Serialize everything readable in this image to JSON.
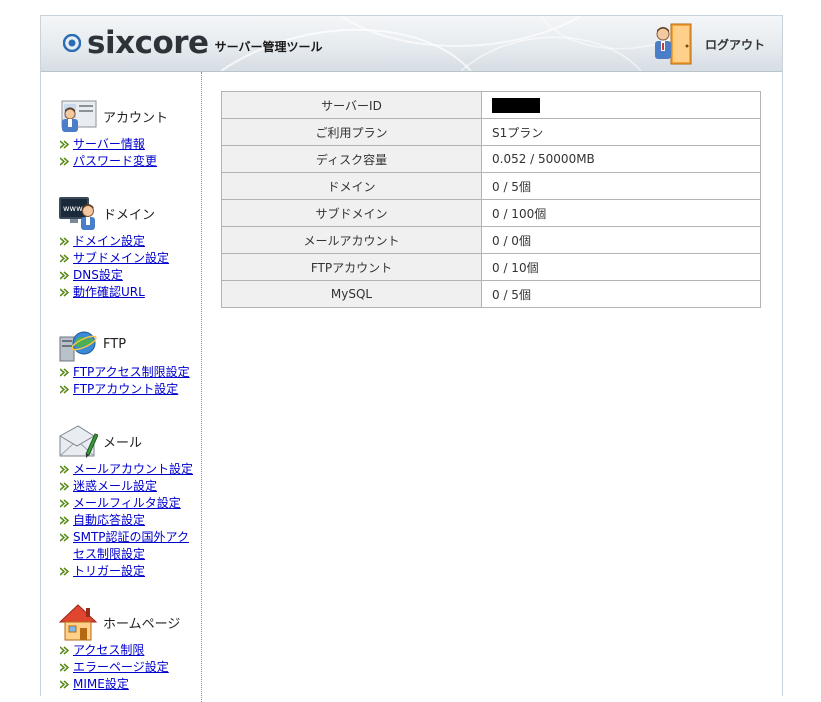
{
  "header": {
    "logo_text": "sixcore",
    "logo_subtitle": "サーバー管理ツール",
    "logout_label": "ログアウト"
  },
  "sidebar": {
    "account": {
      "title": "アカウント",
      "links": [
        "サーバー情報",
        "パスワード変更"
      ]
    },
    "domain": {
      "title": "ドメイン",
      "links": [
        "ドメイン設定",
        "サブドメイン設定",
        "DNS設定",
        "動作確認URL"
      ]
    },
    "ftp": {
      "title": "FTP",
      "links": [
        "FTPアクセス制限設定",
        "FTPアカウント設定"
      ]
    },
    "mail": {
      "title": "メール",
      "links": [
        "メールアカウント設定",
        "迷惑メール設定",
        "メールフィルタ設定",
        "自動応答設定",
        "SMTP認証の国外アク",
        "セス制限設定",
        "トリガー設定"
      ]
    },
    "homepage": {
      "title": "ホームページ",
      "links": [
        "アクセス制限",
        "エラーページ設定",
        "MIME設定"
      ]
    }
  },
  "server_info": {
    "rows": [
      {
        "label": "サーバーID",
        "value": ""
      },
      {
        "label": "ご利用プラン",
        "value": "S1プラン"
      },
      {
        "label": "ディスク容量",
        "value": "0.052 / 50000MB"
      },
      {
        "label": "ドメイン",
        "value": "0 / 5個"
      },
      {
        "label": "サブドメイン",
        "value": "0 / 100個"
      },
      {
        "label": "メールアカウント",
        "value": "0 / 0個"
      },
      {
        "label": "FTPアカウント",
        "value": "0 / 10個"
      },
      {
        "label": "MySQL",
        "value": "0 / 5個"
      }
    ]
  },
  "colors": {
    "link": "#0000cc",
    "arrow": "#5a8a1a",
    "table_border": "#b3b3b3",
    "label_bg": "#f0f0f0"
  }
}
